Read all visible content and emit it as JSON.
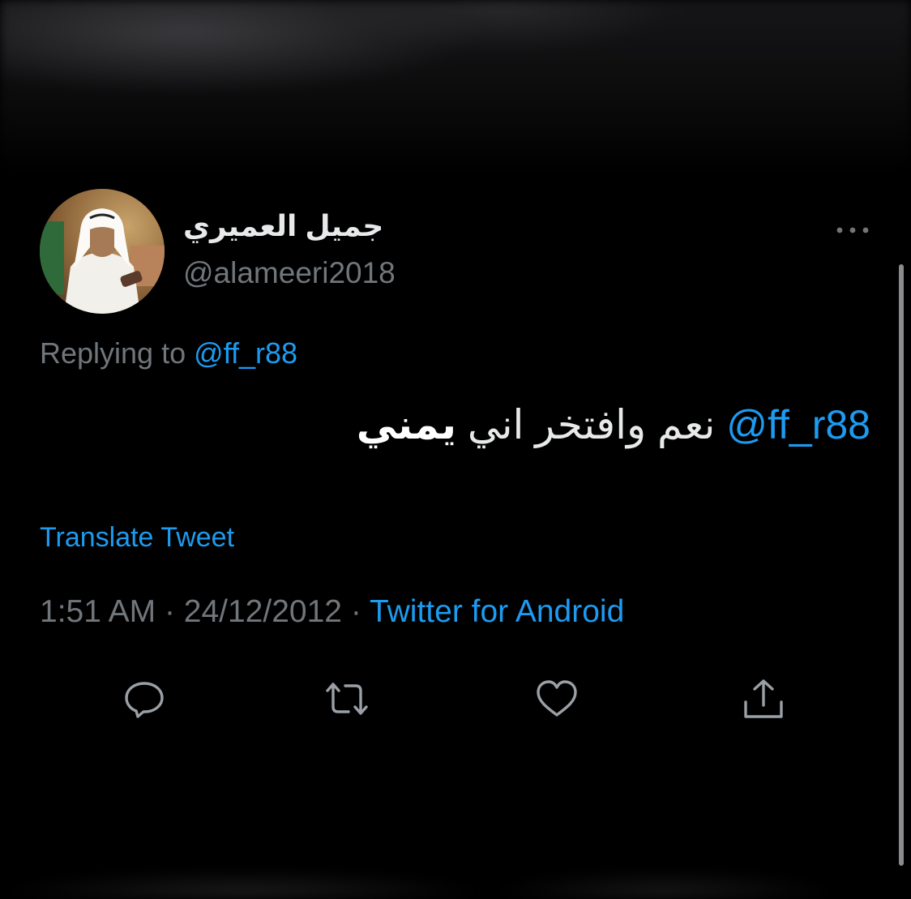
{
  "tweet": {
    "author": {
      "display_name": "جميل العميري",
      "handle": "@alameeri2018"
    },
    "replying_to": {
      "prefix": "Replying to",
      "mention": "@ff_r88"
    },
    "text": {
      "mention": "@ff_r88",
      "body": "نعم وافتخر اني",
      "emphasis": "يمني"
    },
    "translate_label": "Translate Tweet",
    "meta": {
      "time": "1:51 AM",
      "separator": "·",
      "date": "24/12/2012",
      "source": "Twitter for Android"
    },
    "actions": [
      {
        "name": "reply",
        "icon": "speech-bubble-icon"
      },
      {
        "name": "retweet",
        "icon": "retweet-icon"
      },
      {
        "name": "like",
        "icon": "heart-icon"
      },
      {
        "name": "share",
        "icon": "share-upload-icon"
      }
    ],
    "more_icon": "ellipsis-icon"
  },
  "colors": {
    "background": "#000000",
    "primary_text": "#e7e9ea",
    "secondary_text": "#71767b",
    "accent": "#1d9bf0"
  }
}
